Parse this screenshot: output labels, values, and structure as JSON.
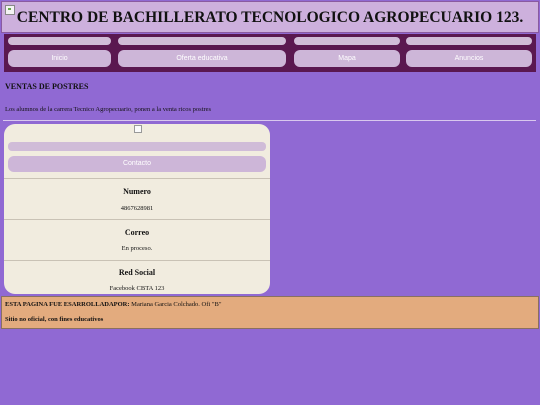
{
  "header": {
    "title": "CENTRO DE BACHILLERATO TECNOLOGICO AGROPECUARIO 123."
  },
  "nav": {
    "items": [
      {
        "label": "Inicio"
      },
      {
        "label": "Oferta educativa"
      },
      {
        "label": "Mapa"
      },
      {
        "label": "Anuncios"
      }
    ]
  },
  "main": {
    "section_title": "VENTAS DE POSTRES",
    "section_text": "Los alumnos de la carrera Tecnico Agropecuario, ponen a la venta ricos postres"
  },
  "contact": {
    "button_label": "Contacto",
    "fields": [
      {
        "label": "Numero",
        "value": "4867628981"
      },
      {
        "label": "Correo",
        "value": "En proceso."
      },
      {
        "label": "Red Social",
        "value": "Facebook CBTA 123"
      }
    ]
  },
  "footer": {
    "credit_label": "ESTA PAGINA FUE ESARROLLADAPOR:",
    "credit_value": " Mariana Garcia Colchado. Ofi \"B\"",
    "note": "Sitio no oficial, con fines educativos"
  },
  "colors": {
    "page_bg": "#9069d3",
    "header_bg": "#cdb0dd",
    "nav_bg": "#5a1850",
    "card_bg": "#f1ecdf",
    "footer_bg": "#e3ab7e"
  }
}
